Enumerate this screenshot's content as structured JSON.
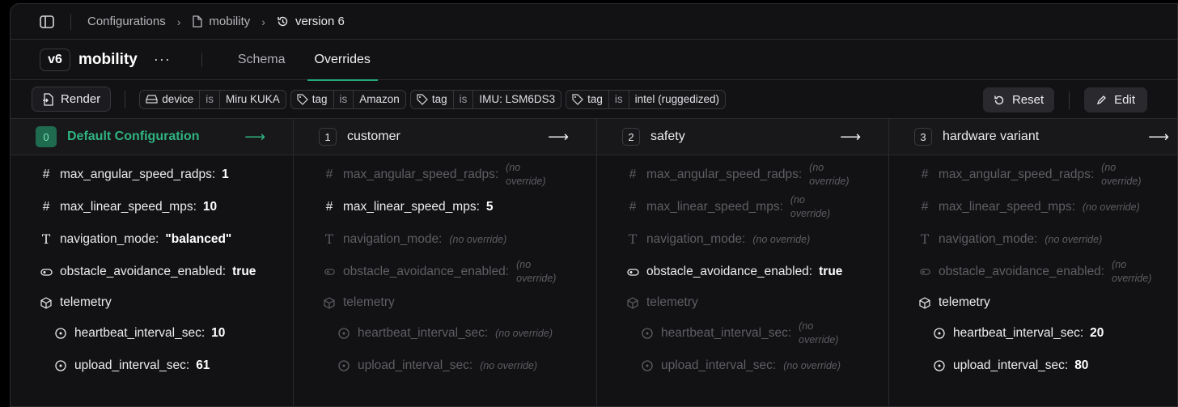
{
  "breadcrumb": {
    "items": [
      "Configurations",
      "mobility",
      "version 6"
    ]
  },
  "header": {
    "version_badge": "v6",
    "config_name": "mobility",
    "more_label": "···",
    "tabs": [
      "Schema",
      "Overrides"
    ]
  },
  "toolbar": {
    "render_label": "Render",
    "reset_label": "Reset",
    "edit_label": "Edit",
    "filters": [
      {
        "key": "device",
        "op": "is",
        "value": "Miru KUKA"
      },
      {
        "key": "tag",
        "op": "is",
        "value": "Amazon"
      },
      {
        "key": "tag",
        "op": "is",
        "value": "IMU: LSM6DS3"
      },
      {
        "key": "tag",
        "op": "is",
        "value": "intel (ruggedized)"
      }
    ]
  },
  "no_override": "(no override)",
  "columns": [
    {
      "index": "0",
      "name": "Default Configuration",
      "rows": {
        "max_angular_speed_radps": "1",
        "max_linear_speed_mps": "10",
        "navigation_mode": "\"balanced\"",
        "obstacle_avoidance_enabled": "true",
        "heartbeat_interval_sec": "10",
        "upload_interval_sec": "61"
      }
    },
    {
      "index": "1",
      "name": "customer",
      "rows": {
        "max_linear_speed_mps": "5"
      }
    },
    {
      "index": "2",
      "name": "safety",
      "rows": {
        "obstacle_avoidance_enabled": "true"
      }
    },
    {
      "index": "3",
      "name": "hardware variant",
      "rows": {
        "heartbeat_interval_sec": "20",
        "upload_interval_sec": "80"
      }
    }
  ],
  "fields": {
    "max_angular_speed_radps": "max_angular_speed_radps:",
    "max_linear_speed_mps": "max_linear_speed_mps:",
    "navigation_mode": "navigation_mode:",
    "obstacle_avoidance_enabled": "obstacle_avoidance_enabled:",
    "telemetry": "telemetry",
    "heartbeat_interval_sec": "heartbeat_interval_sec:",
    "upload_interval_sec": "upload_interval_sec:"
  },
  "colors": {
    "accent": "#2fb37f",
    "background": "#121214"
  }
}
